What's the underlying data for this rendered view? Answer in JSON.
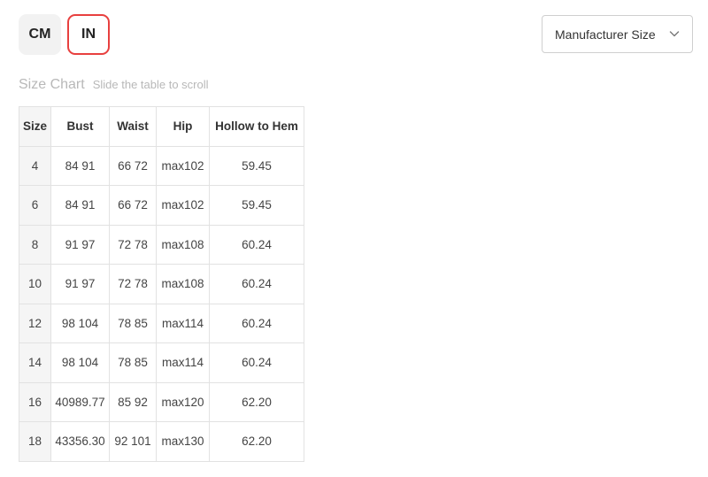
{
  "units": {
    "cm_label": "CM",
    "in_label": "IN",
    "active": "IN"
  },
  "size_select": {
    "selected": "Manufacturer Size",
    "chevron_icon": "chevron-down-icon"
  },
  "chart": {
    "title": "Size Chart",
    "hint": "Slide the table to scroll"
  },
  "table": {
    "headers": [
      "Size",
      "Bust",
      "Waist",
      "Hip",
      "Hollow to Hem"
    ],
    "rows": [
      [
        "4",
        "84 91",
        "66 72",
        "max102",
        "59.45"
      ],
      [
        "6",
        "84 91",
        "66 72",
        "max102",
        "59.45"
      ],
      [
        "8",
        "91 97",
        "72 78",
        "max108",
        "60.24"
      ],
      [
        "10",
        "91 97",
        "72 78",
        "max108",
        "60.24"
      ],
      [
        "12",
        "98 104",
        "78 85",
        "max114",
        "60.24"
      ],
      [
        "14",
        "98 104",
        "78 85",
        "max114",
        "60.24"
      ],
      [
        "16",
        "40989.77",
        "85 92",
        "max120",
        "62.20"
      ],
      [
        "18",
        "43356.30",
        "92 101",
        "max130",
        "62.20"
      ]
    ]
  },
  "colors": {
    "active_border": "#e8403f",
    "inactive_bg": "#f2f2f2",
    "muted_text": "#b8b8b8"
  }
}
